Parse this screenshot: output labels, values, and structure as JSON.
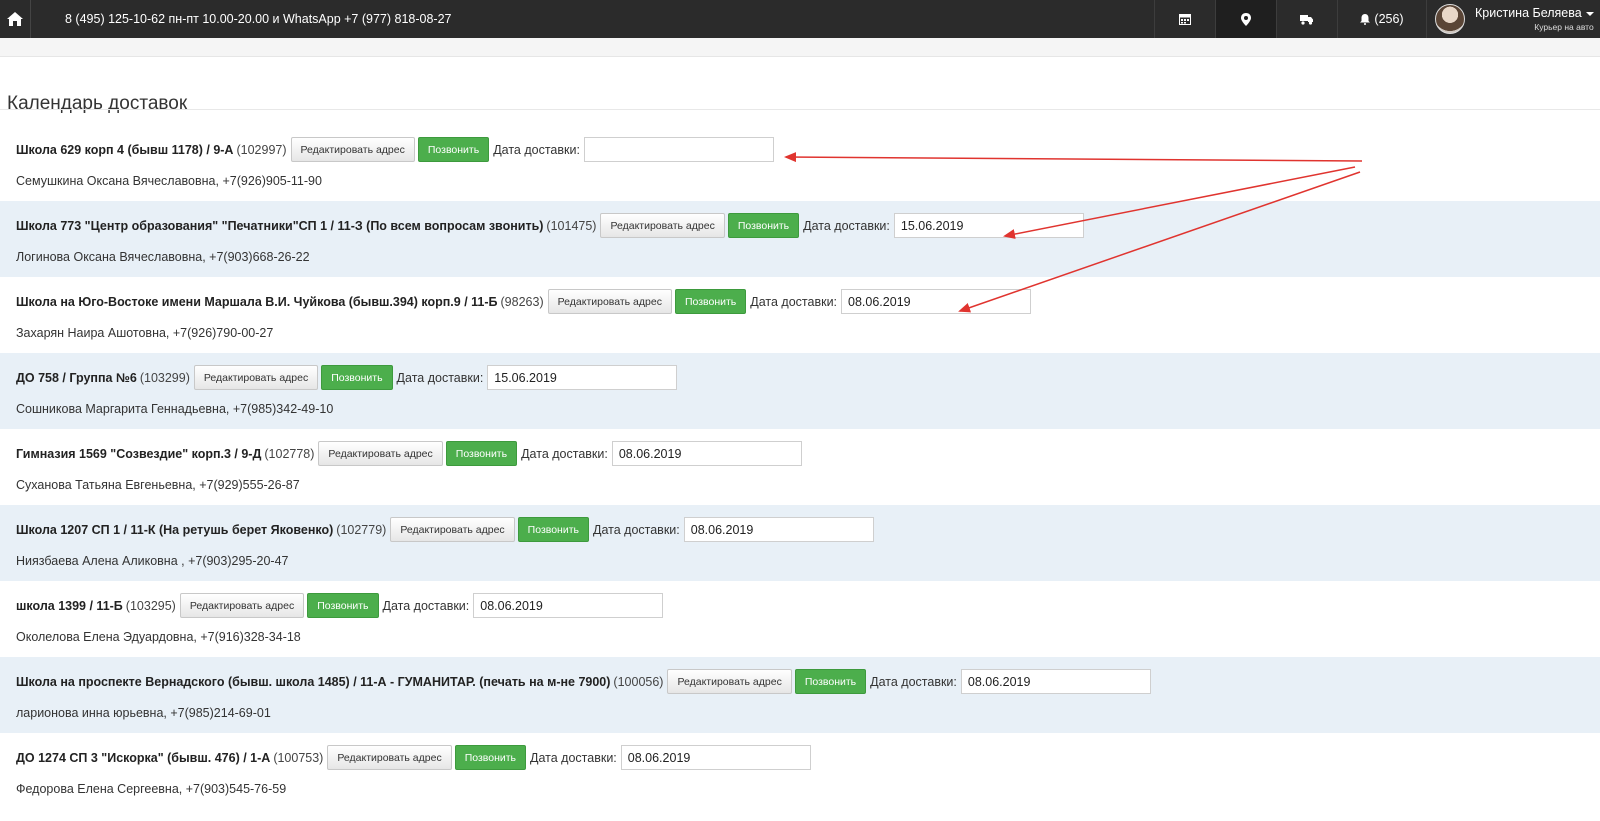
{
  "navbar": {
    "contact": "8 (495) 125-10-62 пн-пт 10.00-20.00 и WhatsApp +7 (977) 818-08-27",
    "notifications": "(256)",
    "user_name": "Кристина Беляева",
    "user_role": "Курьер на авто",
    "icons": [
      "home-icon",
      "calendar-icon",
      "map-marker-icon",
      "truck-icon",
      "bell-icon"
    ]
  },
  "page": {
    "title": "Календарь доставок"
  },
  "labels": {
    "edit_address": "Редактировать адрес",
    "call": "Позвонить",
    "delivery_date": "Дата доставки:"
  },
  "deliveries": [
    {
      "name": "Школа 629 корп 4 (бывш 1178) / 9-А",
      "code": "(102997)",
      "date": "",
      "contact": "Семушкина Оксана Вячеславовна, +7(926)905-11-90"
    },
    {
      "name": "Школа 773 \"Центр образования\" \"Печатники\"СП 1 / 11-З (По всем вопросам звонить)",
      "code": "(101475)",
      "date": "15.06.2019",
      "contact": "Логинова Оксана Вячеславовна, +7(903)668-26-22"
    },
    {
      "name": "Школа на Юго-Востоке имени Маршала В.И. Чуйкова (бывш.394) корп.9 / 11-Б",
      "code": "(98263)",
      "date": "08.06.2019",
      "contact": "Захарян Наира Ашотовна, +7(926)790-00-27"
    },
    {
      "name": "ДО 758 / Группа №6",
      "code": "(103299)",
      "date": "15.06.2019",
      "contact": "Сошникова Маргарита Геннадьевна, +7(985)342-49-10"
    },
    {
      "name": "Гимназия 1569 \"Созвездие\" корп.3 / 9-Д",
      "code": "(102778)",
      "date": "08.06.2019",
      "contact": "Суханова Татьяна Евгеньевна, +7(929)555-26-87"
    },
    {
      "name": "Школа 1207 СП 1 / 11-К (На ретушь берет Яковенко)",
      "code": "(102779)",
      "date": "08.06.2019",
      "contact": "Ниязбаева Алена Аликовна , +7(903)295-20-47"
    },
    {
      "name": "школа 1399 / 11-Б",
      "code": "(103295)",
      "date": "08.06.2019",
      "contact": "Околелова Елена Эдуардовна, +7(916)328-34-18"
    },
    {
      "name": "Школа на проспекте Вернадского (бывш. школа 1485) / 11-А - ГУМАНИТАР. (печать на м-не 7900)",
      "code": "(100056)",
      "date": "08.06.2019",
      "contact": "ларионова инна юрьевна, +7(985)214-69-01"
    },
    {
      "name": "ДО 1274 СП 3 \"Искорка\" (бывш. 476) / 1-А",
      "code": "(100753)",
      "date": "08.06.2019",
      "contact": "Федорова Елена Сергеевна, +7(903)545-76-59"
    }
  ],
  "colors": {
    "navbar": "#2b2b2b",
    "row_alt": "#e8f0f7",
    "call_button": "#4cae4c",
    "annotation_arrow": "#e0342f"
  }
}
